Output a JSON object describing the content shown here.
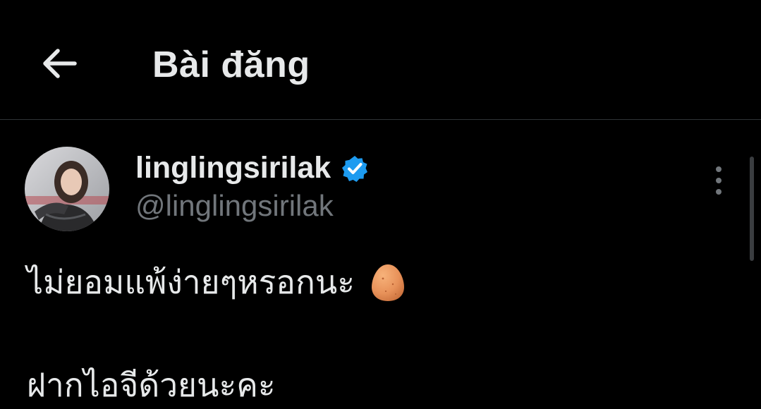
{
  "header": {
    "title": "Bài đăng",
    "back_icon": "arrow-left-icon"
  },
  "post": {
    "author": {
      "display_name": "linglingsirilak",
      "handle": "@linglingsirilak",
      "verified": true
    },
    "text_line_1": "ไม่ยอมแพ้ง่ายๆหรอกนะ",
    "emoji": "egg-emoji",
    "text_line_2": "ฝากไอจีด้วยนะคะ",
    "more_icon": "more-vertical-icon"
  },
  "colors": {
    "background": "#000000",
    "text_primary": "#e7e9ea",
    "text_secondary": "#71767b",
    "verified_blue": "#1d9bf0",
    "divider": "#2f3336"
  }
}
